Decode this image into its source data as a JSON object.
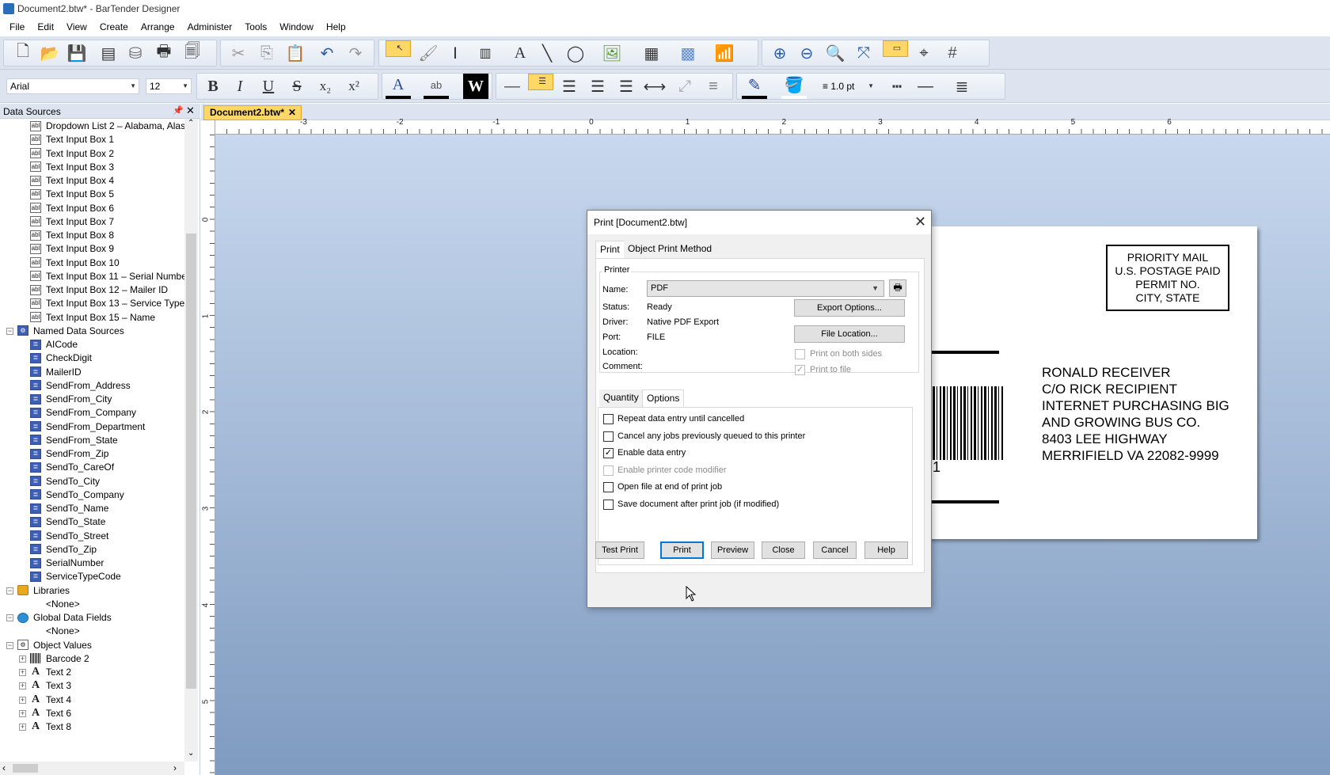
{
  "window": {
    "title": "Document2.btw* - BarTender Designer"
  },
  "menu": [
    "File",
    "Edit",
    "View",
    "Create",
    "Arrange",
    "Administer",
    "Tools",
    "Window",
    "Help"
  ],
  "toolbar": {
    "font_name": "Arial",
    "font_size": "12",
    "line_width": "1.0 pt"
  },
  "panel": {
    "title": "Data Sources"
  },
  "tree": [
    {
      "label": "Dropdown List 2 – Alabama, Alas",
      "icon": "dropdown-icon",
      "indent": 2
    },
    {
      "label": "Text Input Box 1",
      "icon": "text-input-icon",
      "indent": 2
    },
    {
      "label": "Text Input Box 2",
      "icon": "text-input-icon",
      "indent": 2
    },
    {
      "label": "Text Input Box 3",
      "icon": "text-input-icon",
      "indent": 2
    },
    {
      "label": "Text Input Box 4",
      "icon": "text-input-icon",
      "indent": 2
    },
    {
      "label": "Text Input Box 5",
      "icon": "text-input-icon",
      "indent": 2
    },
    {
      "label": "Text Input Box 6",
      "icon": "text-input-icon",
      "indent": 2
    },
    {
      "label": "Text Input Box 7",
      "icon": "text-input-icon",
      "indent": 2
    },
    {
      "label": "Text Input Box 8",
      "icon": "text-input-icon",
      "indent": 2
    },
    {
      "label": "Text Input Box 9",
      "icon": "text-input-icon",
      "indent": 2
    },
    {
      "label": "Text Input Box 10",
      "icon": "text-input-icon",
      "indent": 2
    },
    {
      "label": "Text Input Box 11 – Serial Numbe",
      "icon": "text-input-icon",
      "indent": 2
    },
    {
      "label": "Text Input Box 12 – Mailer ID",
      "icon": "text-input-icon",
      "indent": 2
    },
    {
      "label": "Text Input Box 13 – Service Type",
      "icon": "text-input-icon",
      "indent": 2
    },
    {
      "label": "Text Input Box 15 – Name",
      "icon": "text-input-icon",
      "indent": 2
    },
    {
      "label": "Named Data Sources",
      "icon": "named-data-sources-icon",
      "indent": 1,
      "expander": "⊟"
    },
    {
      "label": "AICode",
      "icon": "named-data-source-icon",
      "indent": 2
    },
    {
      "label": "CheckDigit",
      "icon": "named-data-source-icon",
      "indent": 2
    },
    {
      "label": "MailerID",
      "icon": "named-data-source-icon",
      "indent": 2
    },
    {
      "label": "SendFrom_Address",
      "icon": "named-data-source-icon",
      "indent": 2
    },
    {
      "label": "SendFrom_City",
      "icon": "named-data-source-icon",
      "indent": 2
    },
    {
      "label": "SendFrom_Company",
      "icon": "named-data-source-icon",
      "indent": 2
    },
    {
      "label": "SendFrom_Department",
      "icon": "named-data-source-icon",
      "indent": 2
    },
    {
      "label": "SendFrom_State",
      "icon": "named-data-source-icon",
      "indent": 2
    },
    {
      "label": "SendFrom_Zip",
      "icon": "named-data-source-icon",
      "indent": 2
    },
    {
      "label": "SendTo_CareOf",
      "icon": "named-data-source-icon",
      "indent": 2
    },
    {
      "label": "SendTo_City",
      "icon": "named-data-source-icon",
      "indent": 2
    },
    {
      "label": "SendTo_Company",
      "icon": "named-data-source-icon",
      "indent": 2
    },
    {
      "label": "SendTo_Name",
      "icon": "named-data-source-icon",
      "indent": 2
    },
    {
      "label": "SendTo_State",
      "icon": "named-data-source-icon",
      "indent": 2
    },
    {
      "label": "SendTo_Street",
      "icon": "named-data-source-icon",
      "indent": 2
    },
    {
      "label": "SendTo_Zip",
      "icon": "named-data-source-icon",
      "indent": 2
    },
    {
      "label": "SerialNumber",
      "icon": "named-data-source-icon",
      "indent": 2
    },
    {
      "label": "ServiceTypeCode",
      "icon": "named-data-source-icon",
      "indent": 2
    },
    {
      "label": "Libraries",
      "icon": "libraries-icon",
      "indent": 1,
      "expander": "⊟"
    },
    {
      "label": "<None>",
      "icon": "",
      "indent": 2
    },
    {
      "label": "Global Data Fields",
      "icon": "globe-icon",
      "indent": 1,
      "expander": "⊟"
    },
    {
      "label": "<None>",
      "icon": "",
      "indent": 2
    },
    {
      "label": "Object Values",
      "icon": "object-values-icon",
      "indent": 1,
      "expander": "⊟"
    },
    {
      "label": "Barcode 2",
      "icon": "barcode-icon",
      "indent": 2,
      "expander": "⊞"
    },
    {
      "label": "Text 2",
      "icon": "text-object-icon",
      "indent": 2,
      "expander": "⊞"
    },
    {
      "label": "Text 3",
      "icon": "text-object-icon",
      "indent": 2,
      "expander": "⊞"
    },
    {
      "label": "Text 4",
      "icon": "text-object-icon",
      "indent": 2,
      "expander": "⊞"
    },
    {
      "label": "Text 6",
      "icon": "text-object-icon",
      "indent": 2,
      "expander": "⊞"
    },
    {
      "label": "Text 8",
      "icon": "text-object-icon",
      "indent": 2,
      "expander": "⊞"
    }
  ],
  "doc_tab": "Document2.btw*",
  "ruler": {
    "h": [
      "-3",
      "-2",
      "-1",
      "0",
      "1",
      "2",
      "3",
      "4",
      "5",
      "6"
    ],
    "v": [
      "0",
      "1",
      "2",
      "3",
      "4",
      "5"
    ]
  },
  "label": {
    "postage": [
      "PRIORITY MAIL",
      "U.S. POSTAGE PAID",
      "PERMIT NO.",
      "CITY, STATE"
    ],
    "address": [
      "RONALD RECEIVER",
      "C/O RICK RECIPIENT",
      "INTERNET PURCHASING BIG",
      "AND GROWING BUS CO.",
      "8403 LEE HIGHWAY",
      "MERRIFIELD VA 22082-9999"
    ],
    "barcode_digit": "1"
  },
  "dialog": {
    "title": "Print [Document2.btw]",
    "tabs": [
      "Print",
      "Object Print Method"
    ],
    "printer_group": "Printer",
    "name_label": "Name:",
    "name_value": "PDF",
    "status_label": "Status:",
    "status_value": "Ready",
    "driver_label": "Driver:",
    "driver_value": "Native PDF Export",
    "port_label": "Port:",
    "port_value": "FILE",
    "location_label": "Location:",
    "comment_label": "Comment:",
    "export_options": "Export Options...",
    "file_location": "File Location...",
    "print_both_sides": "Print on both sides",
    "print_to_file": "Print to file",
    "sub_tabs": [
      "Quantity",
      "Options"
    ],
    "options": [
      {
        "label": "Repeat data entry until cancelled",
        "checked": false,
        "disabled": false
      },
      {
        "label": "Cancel any jobs previously queued to this printer",
        "checked": false,
        "disabled": false
      },
      {
        "label": "Enable data entry",
        "checked": true,
        "disabled": false
      },
      {
        "label": "Enable printer code modifier",
        "checked": false,
        "disabled": true
      },
      {
        "label": "Open file at end of print job",
        "checked": false,
        "disabled": false
      },
      {
        "label": "Save document after print job (if modified)",
        "checked": false,
        "disabled": false
      }
    ],
    "buttons": [
      "Test Print",
      "Print",
      "Preview",
      "Close",
      "Cancel",
      "Help"
    ]
  }
}
